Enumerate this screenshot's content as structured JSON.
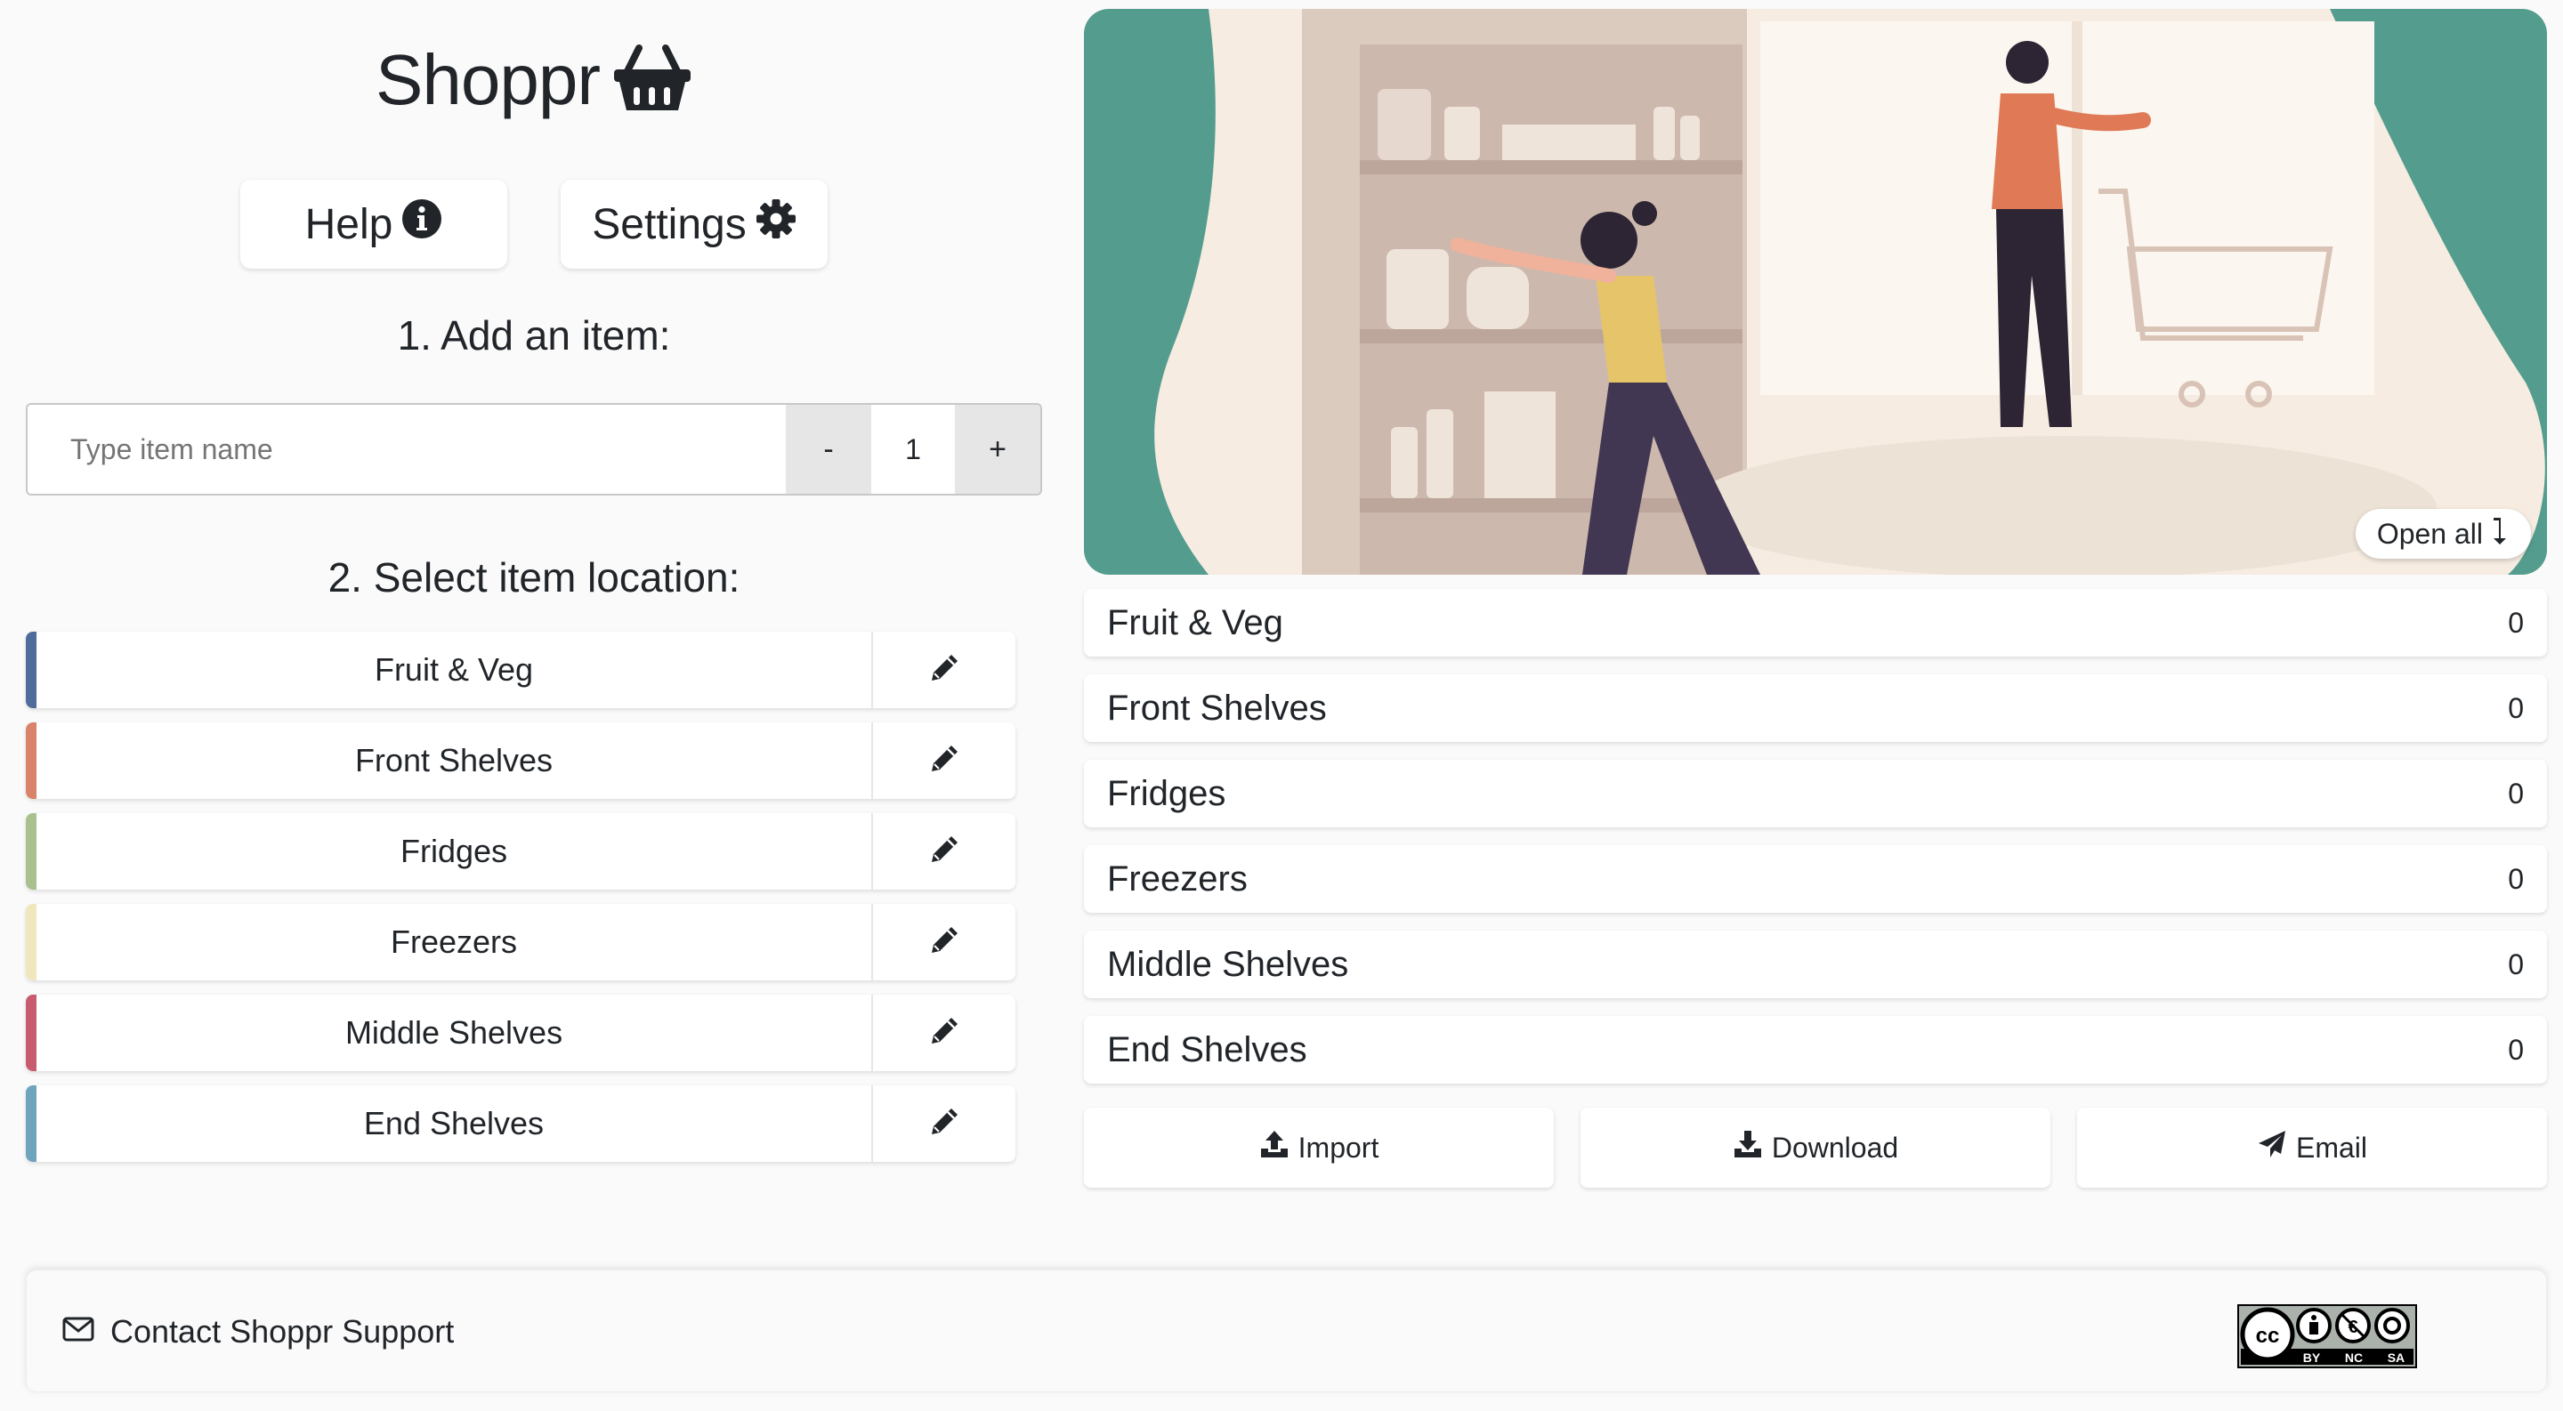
{
  "app": {
    "brand_name": "Shoppr",
    "brand_icon": "shopping-basket-icon"
  },
  "top_buttons": {
    "help_label": "Help",
    "help_icon": "info-circle-icon",
    "settings_label": "Settings",
    "settings_icon": "gear-icon"
  },
  "add_item": {
    "heading": "1. Add an item:",
    "placeholder": "Type item name",
    "value": "",
    "decrement_label": "-",
    "quantity": "1",
    "increment_label": "+"
  },
  "location": {
    "heading": "2. Select item location:",
    "items": [
      {
        "label": "Fruit & Veg",
        "color": "#4f6d9a"
      },
      {
        "label": "Front Shelves",
        "color": "#d9836b"
      },
      {
        "label": "Fridges",
        "color": "#a9c08f"
      },
      {
        "label": "Freezers",
        "color": "#f1e7bf"
      },
      {
        "label": "Middle Shelves",
        "color": "#c95b6e"
      },
      {
        "label": "End Shelves",
        "color": "#6fa4bd"
      }
    ],
    "edit_icon": "pencil-icon"
  },
  "hero": {
    "open_all_label": "Open all",
    "open_all_icon": "arrow-down-icon",
    "accent_color": "#549d8e"
  },
  "summary": {
    "items": [
      {
        "label": "Fruit & Veg",
        "count": "0"
      },
      {
        "label": "Front Shelves",
        "count": "0"
      },
      {
        "label": "Fridges",
        "count": "0"
      },
      {
        "label": "Freezers",
        "count": "0"
      },
      {
        "label": "Middle Shelves",
        "count": "0"
      },
      {
        "label": "End Shelves",
        "count": "0"
      }
    ]
  },
  "actions": {
    "import_label": "Import",
    "download_label": "Download",
    "email_label": "Email"
  },
  "footer": {
    "contact_label": "Contact Shoppr Support",
    "contact_icon": "envelope-icon",
    "license": {
      "icon": "creative-commons-badge",
      "terms": [
        "BY",
        "NC",
        "SA"
      ]
    }
  }
}
